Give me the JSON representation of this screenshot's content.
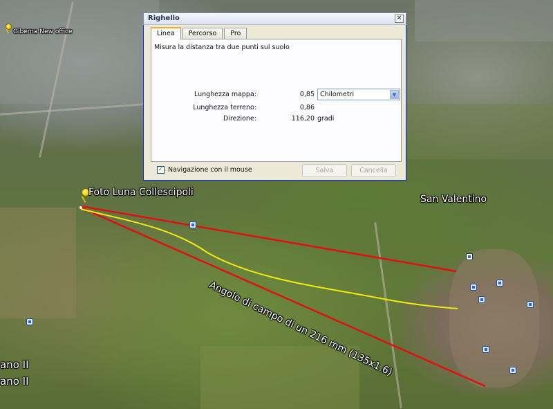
{
  "window": {
    "title": "Righello",
    "close_glyph": "✕"
  },
  "tabs": [
    {
      "label": "Linea",
      "active": true
    },
    {
      "label": "Percorso",
      "active": false
    },
    {
      "label": "Pro",
      "active": false
    }
  ],
  "linea": {
    "description": "Misura la distanza tra due punti sul suolo",
    "map_length": {
      "label": "Lunghezza mappa:",
      "value": "0,85",
      "unit": "Chilometri"
    },
    "ground_length": {
      "label": "Lunghezza terreno:",
      "value": "0,86"
    },
    "heading": {
      "label": "Direzione:",
      "value": "116,20",
      "unit": "gradi"
    }
  },
  "footer": {
    "mouse_nav": {
      "label": "Navigazione con il mouse",
      "checked": true,
      "check_glyph": "✓"
    },
    "save_label": "Salva",
    "cancel_label": "Cancella"
  },
  "dropdown_arrow_glyph": "▼",
  "map": {
    "labels": {
      "giberna": "Giberna New office",
      "foto_luna": "Foto Luna Collescipoli",
      "san_valentino": "San Valentino",
      "angolo": "Angolo di campo di un 216 mm (135x1.6)",
      "left_a": "ano II",
      "left_b": "ano II"
    },
    "colors": {
      "red_line": "#e01010",
      "yellow_path": "#f2ea10",
      "placemark": "#f2d600"
    },
    "icon_names": [
      "placemark-pin-icon",
      "poi-icon",
      "envelope-icon"
    ]
  }
}
